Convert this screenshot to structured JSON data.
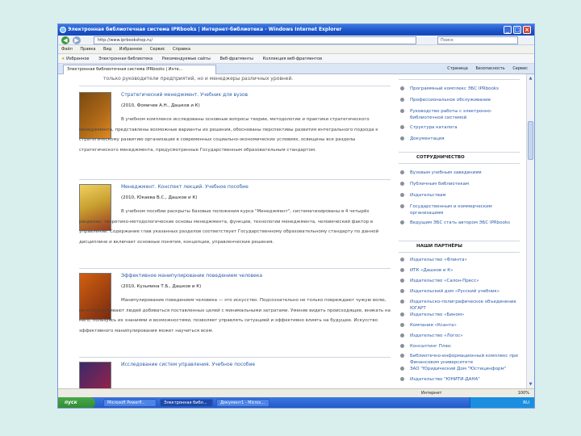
{
  "window": {
    "title": "Электронная библиотечная система IPRbooks | Интернет-библиотека - Windows Internet Explorer"
  },
  "address": {
    "url": "http://www.iprbookshop.ru/",
    "search_placeholder": "Поиск"
  },
  "menu": [
    "Файл",
    "Правка",
    "Вид",
    "Избранное",
    "Сервис",
    "Справка"
  ],
  "favorites": {
    "label": "Избранное",
    "items": [
      "Электронная библиотека",
      "Рекомендуемые сайты",
      "Веб-фрагменты",
      "Коллекция веб-фрагментов"
    ]
  },
  "tab": {
    "label": "Электронная библиотечная система IPRbooks | Инте..."
  },
  "commands": [
    "Страница",
    "Безопасность",
    "Сервис"
  ],
  "content": {
    "top_line": "только руководители предприятий, но и менеджеры различных уровней.",
    "books": [
      {
        "title": "Стратегический менеджмент. Учебник для вузов",
        "authors": "(2010, Фомичев А.Н., Дашков и К)",
        "desc": "В учебном комплексе исследованы основные вопросы теории, методологии и практики стратегического менеджмента, представлены возможные варианты их решения, обоснованы перспективы развития интегрального подхода к стратегическому развитию организации в современных социально-экономических условиях, освещены все разделы стратегического менеджмента, предусмотренные Государственным образовательным стандартом."
      },
      {
        "title": "Менеджмент. Конспект лекций. Учебное пособие",
        "authors": "(2010, Юкаева В.С., Дашков и К)",
        "desc": "В учебном пособии раскрыты базовые положения курса \"Менеджмент\", систематизированы в 4 четырёх разделах: теоретико-методологические основы менеджмента, функции, технологии менеджмента, человеческий фактор в управлении. Содержание глав указанных разделов соответствует Государственному образовательному стандарту по данной дисциплине и включает основные понятия, концепции, управленческие решения."
      },
      {
        "title": "Эффективное манипулирование поведением человека",
        "authors": "(2010, Кузьмина Т.Б., Дашков и К)",
        "desc": "Манипулирование поведением человека — это искусство. Подсознательно не только повреждают чужую волю, но и подталкивают людей добиваться поставленных целей с минимальными затратами. Умение видеть происходящее, вникать на него, пользуясь их знаниями и возможностями, позволяет управлять ситуацией и эффективно влиять на будущее. Искусство эффективного манипулирования может научиться всем."
      },
      {
        "title": "Исследование систем управления. Учебное пособие",
        "authors": "",
        "desc": ""
      }
    ]
  },
  "sidebar": {
    "sections": [
      {
        "heading": "",
        "items": [
          "Программный комплекс ЭБС IPRbooks",
          "Профессиональное обслуживание",
          "Руководство работы с электронно-библиотечной системой",
          "Структура каталога",
          "Документация"
        ]
      },
      {
        "heading": "СОТРУДНИЧЕСТВО",
        "items": [
          "Вузовым учебным заведениям",
          "Публичным библиотекам",
          "Издательствам",
          "Государственным и коммерческим организациям",
          "Ведущим ЭБС стать автором ЭБС IPRbooks"
        ]
      },
      {
        "heading": "НАШИ ПАРТНЁРЫ",
        "items": [
          "Издательство «Флинта»",
          "ИТК «Дашков и К»",
          "Издательство «Салон-Пресс»",
          "Издательский дом «Русский учебник»",
          "Издательско-полиграфическое объединение ЮГАРТ",
          "Издательство «Бином»",
          "Компания «Ксанта»",
          "Издательство «Логос»",
          "Консалтинг Плюс",
          "Библиотечно-информационный комплекс при Финансовом университете",
          "ЗАО \"Юридический Дом \"Юстицинформ\"",
          "Издательство \"ЮНИТИ-ДАНА\""
        ]
      }
    ]
  },
  "status": {
    "zone": "Интернет",
    "zoom": "100%"
  },
  "taskbar": {
    "start": "пуск",
    "tasks": [
      "Microsoft PowerP...",
      "Электронная библ...",
      "Документ1 - Micros..."
    ],
    "tray": "RU"
  }
}
